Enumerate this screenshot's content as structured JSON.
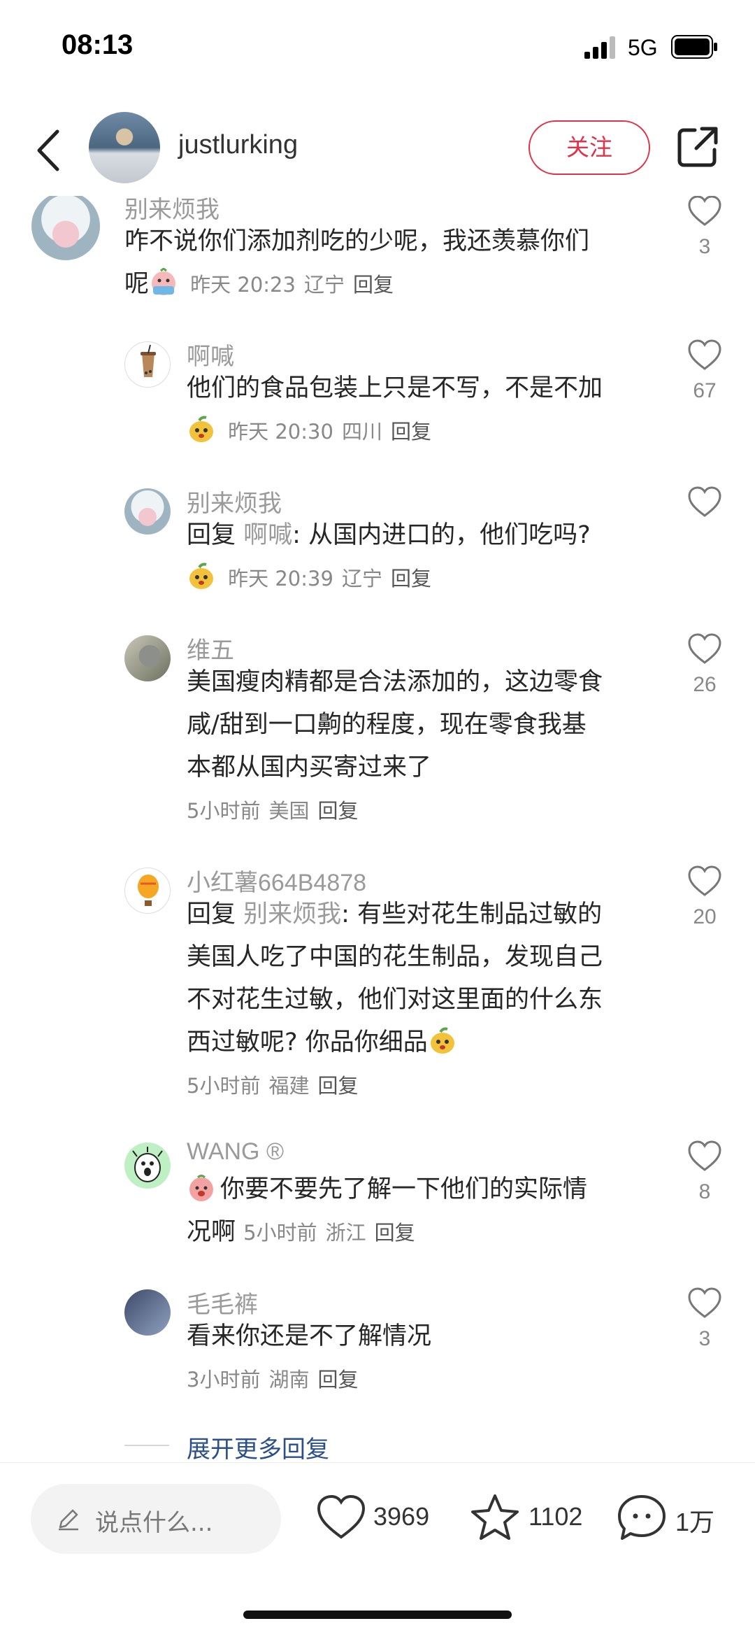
{
  "status_bar": {
    "time": "08:13",
    "network": "5G"
  },
  "header": {
    "username": "justlurking",
    "follow_label": "关注"
  },
  "comments": [
    {
      "name": "别来烦我",
      "text_line1": "咋不说你们添加剂吃的少呢，我还羡慕你们",
      "text_line2": "呢",
      "time": "昨天 20:23",
      "location": "辽宁",
      "reply_label": "回复",
      "likes": "3"
    },
    {
      "name": "啊喊",
      "text": "他们的食品包装上只是不写，不是不加",
      "time": "昨天 20:30",
      "location": "四川",
      "reply_label": "回复",
      "likes": "67"
    },
    {
      "name": "别来烦我",
      "reply_prefix": "回复",
      "mention": "啊喊",
      "text": ": 从国内进口的，他们吃吗?",
      "time": "昨天 20:39",
      "location": "辽宁",
      "reply_label": "回复",
      "likes": ""
    },
    {
      "name": "维五",
      "text_line1": "美国瘦肉精都是合法添加的，这边零食",
      "text_line2": "咸/甜到一口齁的程度，现在零食我基",
      "text_line3": "本都从国内买寄过来了",
      "time": "5小时前",
      "location": "美国",
      "reply_label": "回复",
      "likes": "26"
    },
    {
      "name": "小红薯664B4878",
      "reply_prefix": "回复",
      "mention": "别来烦我",
      "text_line1": ": 有些对花生制品过敏的",
      "text_line2": "美国人吃了中国的花生制品，发现自己",
      "text_line3": "不对花生过敏，他们对这里面的什么东",
      "text_line4": "西过敏呢? 你品你细品",
      "time": "5小时前",
      "location": "福建",
      "reply_label": "回复",
      "likes": "20"
    },
    {
      "name": "WANG ®",
      "text_line1": "你要不要先了解一下他们的实际情",
      "text_line2": "况啊",
      "time": "5小时前",
      "location": "浙江",
      "reply_label": "回复",
      "likes": "8"
    },
    {
      "name": "毛毛裤",
      "text": "看来你还是不了解情况",
      "time": "3小时前",
      "location": "湖南",
      "reply_label": "回复",
      "likes": "3"
    }
  ],
  "expand_more_label": "展开更多回复",
  "bottom_bar": {
    "input_placeholder": "说点什么...",
    "likes": "3969",
    "favorites": "1102",
    "comments": "1万"
  },
  "colors": {
    "accent": "#e0334a",
    "link": "#2a4f8a"
  },
  "icons": [
    "back-icon",
    "share-icon",
    "heart-icon",
    "star-icon",
    "comment-icon",
    "pencil-icon"
  ]
}
